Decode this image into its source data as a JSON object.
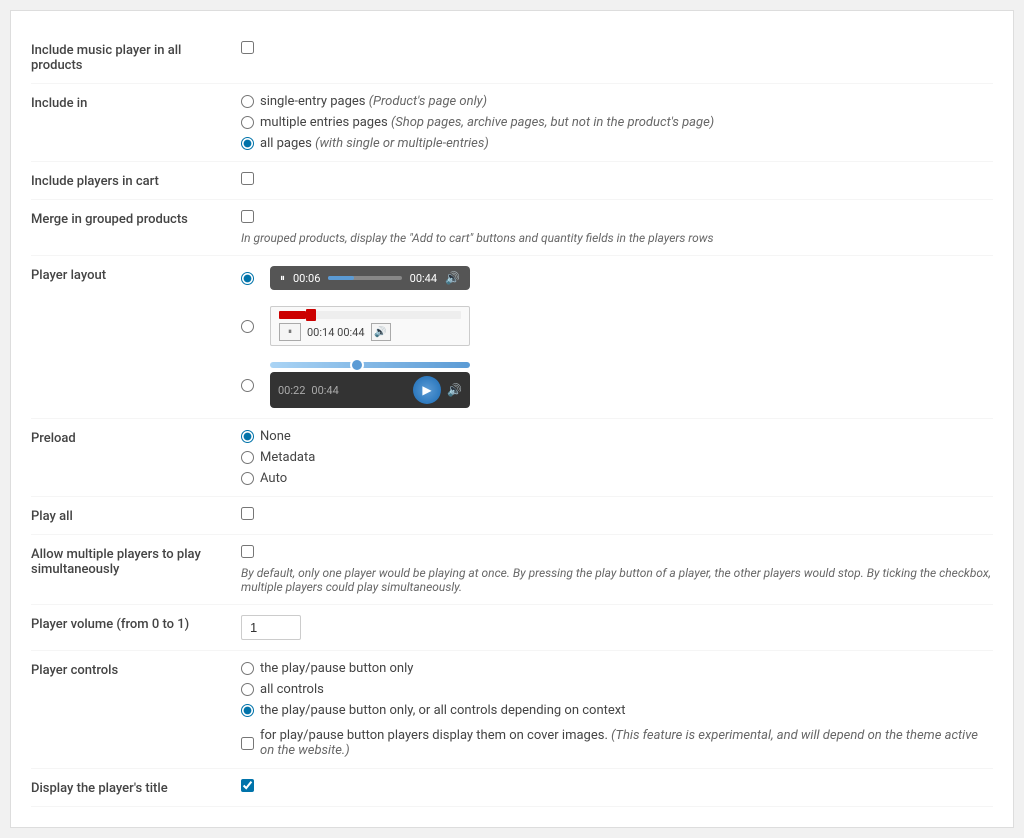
{
  "rows": {
    "include_music_player": {
      "label": "Include music player in all products"
    },
    "include_in": {
      "label": "Include in",
      "options": [
        {
          "id": "single",
          "label": "single-entry pages",
          "italic": "(Product's page only)",
          "checked": false
        },
        {
          "id": "multiple",
          "label": "multiple entries pages",
          "italic": "(Shop pages, archive pages, but not in the product's page)",
          "checked": false
        },
        {
          "id": "all",
          "label": "all pages",
          "italic": "(with single or multiple-entries)",
          "checked": true
        }
      ]
    },
    "include_players_in_cart": {
      "label": "Include players in cart"
    },
    "merge_in_grouped": {
      "label": "Merge in grouped products",
      "helper": "In grouped products, display the \"Add to cart\" buttons and quantity fields in the players rows"
    },
    "player_layout": {
      "label": "Player layout",
      "player1": {
        "time1": "00:06",
        "time2": "00:44"
      },
      "player2": {
        "time1": "00:14",
        "time2": "00:44"
      },
      "player3": {
        "time1": "00:22",
        "time2": "00:44"
      }
    },
    "preload": {
      "label": "Preload",
      "options": [
        {
          "id": "none",
          "label": "None",
          "checked": true
        },
        {
          "id": "metadata",
          "label": "Metadata",
          "checked": false
        },
        {
          "id": "auto",
          "label": "Auto",
          "checked": false
        }
      ]
    },
    "play_all": {
      "label": "Play all"
    },
    "allow_multiple": {
      "label": "Allow multiple players to play simultaneously",
      "helper": "By default, only one player would be playing at once. By pressing the play button of a player, the other players would stop. By ticking the checkbox, multiple players could play simultaneously."
    },
    "player_volume": {
      "label": "Player volume (from 0 to 1)",
      "value": "1"
    },
    "player_controls": {
      "label": "Player controls",
      "options": [
        {
          "id": "play_only",
          "label": "the play/pause button only",
          "checked": false
        },
        {
          "id": "all_controls",
          "label": "all controls",
          "checked": false
        },
        {
          "id": "context",
          "label": "the play/pause button only, or all controls depending on context",
          "checked": true
        }
      ],
      "extra_label": "for play/pause button players display them on cover images.",
      "extra_italic": "(This feature is experimental, and will depend on the theme active on the website.)"
    },
    "display_title": {
      "label": "Display the player's title"
    }
  }
}
